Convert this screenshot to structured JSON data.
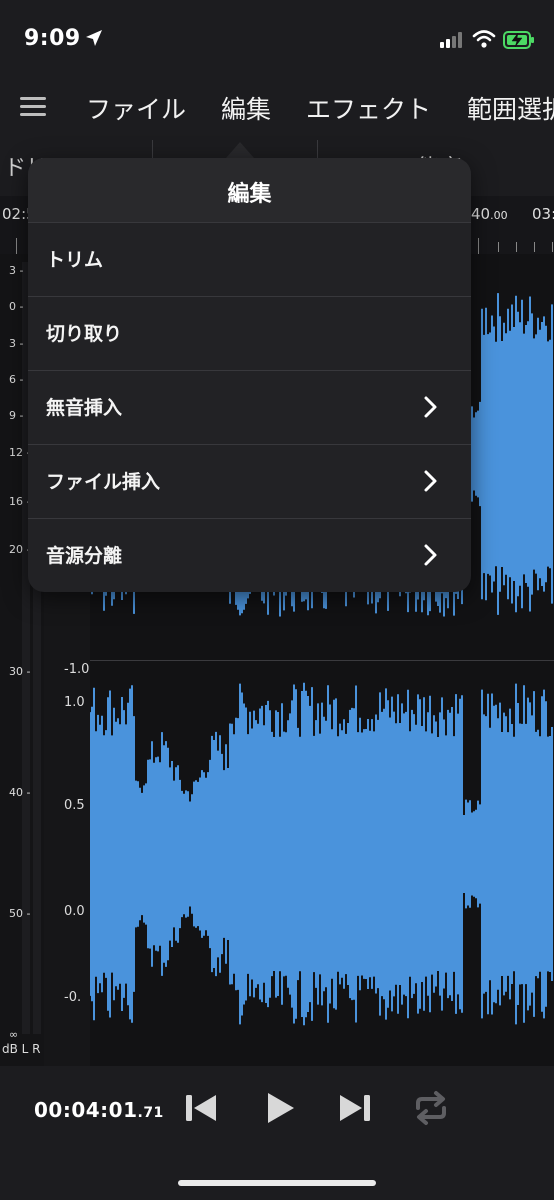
{
  "status_bar": {
    "time": "9:09"
  },
  "menu_bar": {
    "items": [
      "ファイル",
      "編集",
      "エフェクト",
      "範囲選択"
    ]
  },
  "toolbar_peek": {
    "left": "ドリ・ション",
    "middle": "・ド・・・",
    "right": "✕ ・・・能率"
  },
  "timeline": {
    "left_label": "02:5",
    "mid_main": "40",
    "mid_frac": ".00",
    "right_label": "03:"
  },
  "db_meter": {
    "labels": [
      "3 -",
      "0 -",
      "3 -",
      "6 -",
      "9 -",
      "12 -",
      "16 -",
      "20 -",
      "30 -",
      "40 -",
      "50 -",
      "∞"
    ],
    "footer": "dB L R"
  },
  "amp_scale": {
    "labels": [
      "-1.0",
      "1.0",
      "0.5",
      "0.0",
      "-0."
    ]
  },
  "edit_popover": {
    "title": "編集",
    "items": [
      {
        "label": "トリム",
        "submenu": false
      },
      {
        "label": "切り取り",
        "submenu": false
      },
      {
        "label": "無音挿入",
        "submenu": true
      },
      {
        "label": "ファイル挿入",
        "submenu": true
      },
      {
        "label": "音源分離",
        "submenu": true
      }
    ]
  },
  "transport": {
    "time_main": "00:04:01",
    "time_frac": ".71",
    "loop_enabled": false
  },
  "colors": {
    "waveform": "#4a93dc",
    "background": "#121214",
    "panel": "#222225"
  }
}
